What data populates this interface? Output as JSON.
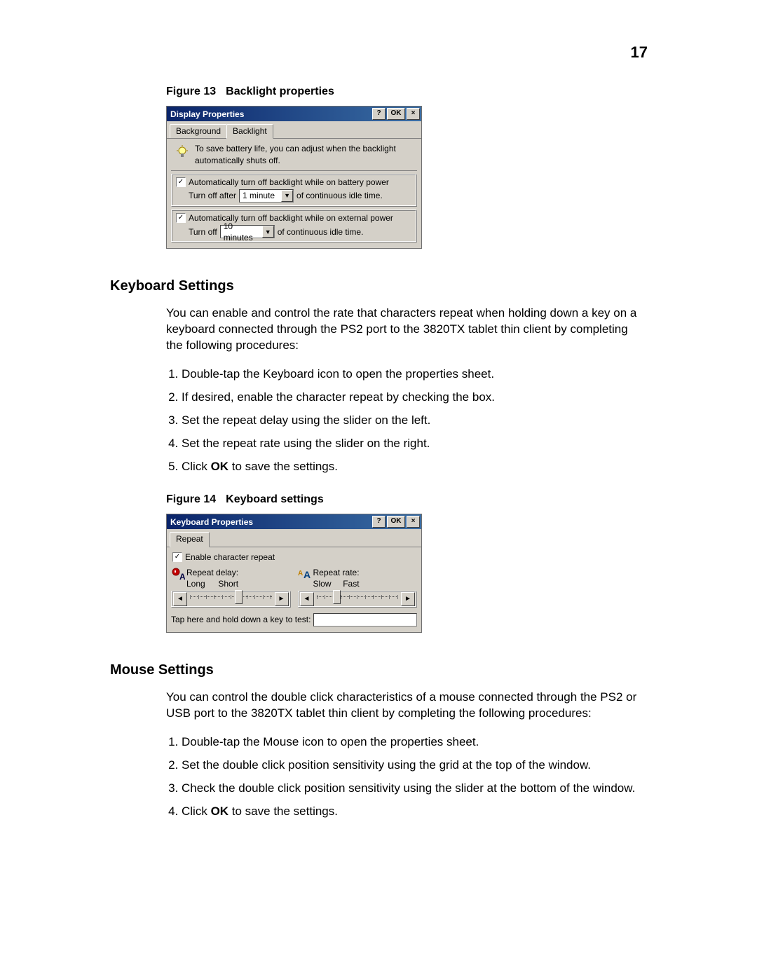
{
  "page_number": "17",
  "figure13": {
    "caption_prefix": "Figure 13",
    "caption_text": "Backlight properties",
    "title": "Display Properties",
    "btn_help": "?",
    "btn_ok": "OK",
    "btn_close": "×",
    "tabs": {
      "background": "Background",
      "backlight": "Backlight"
    },
    "info_text": "To save battery life, you can adjust when the backlight automatically shuts off.",
    "battery": {
      "chk_label": "Automatically turn off backlight while on battery power",
      "turnoff_pre": "Turn off after",
      "combo_value": "1 minute",
      "turnoff_post": "of continuous idle time."
    },
    "external": {
      "chk_label": "Automatically turn off backlight while on external power",
      "turnoff_pre": "Turn off",
      "combo_value": "10 minutes",
      "turnoff_post": "of continuous idle time."
    }
  },
  "keyboard_section": {
    "heading": "Keyboard Settings",
    "intro": "You can enable and control the rate that characters repeat when holding down a key on a keyboard connected through the PS2 port to the 3820TX tablet thin client by completing the following procedures:",
    "steps": [
      "Double-tap the Keyboard icon to open the properties sheet.",
      "If desired, enable the character repeat by checking the box.",
      "Set the repeat delay using the slider on the left.",
      "Set the repeat rate using the slider on the right."
    ],
    "step5_pre": "Click ",
    "step5_bold": "OK",
    "step5_post": " to save the settings."
  },
  "figure14": {
    "caption_prefix": "Figure 14",
    "caption_text": "Keyboard settings",
    "title": "Keyboard Properties",
    "btn_help": "?",
    "btn_ok": "OK",
    "btn_close": "×",
    "tab_repeat": "Repeat",
    "enable_label": "Enable character repeat",
    "delay": {
      "label": "Repeat delay:",
      "left": "Long",
      "right": "Short"
    },
    "rate": {
      "label": "Repeat rate:",
      "left": "Slow",
      "right": "Fast"
    },
    "test_label": "Tap here and hold down a key to test:"
  },
  "mouse_section": {
    "heading": "Mouse Settings",
    "intro": "You can control the double click characteristics of a mouse connected through the PS2 or USB port to the 3820TX tablet thin client by completing the following procedures:",
    "steps": [
      "Double-tap the Mouse icon to open the properties sheet.",
      "Set the double click position sensitivity using the grid at the top of the window.",
      "Check the double click position sensitivity using the slider at the bottom of the window."
    ],
    "step4_pre": "Click ",
    "step4_bold": "OK",
    "step4_post": " to save the settings."
  }
}
